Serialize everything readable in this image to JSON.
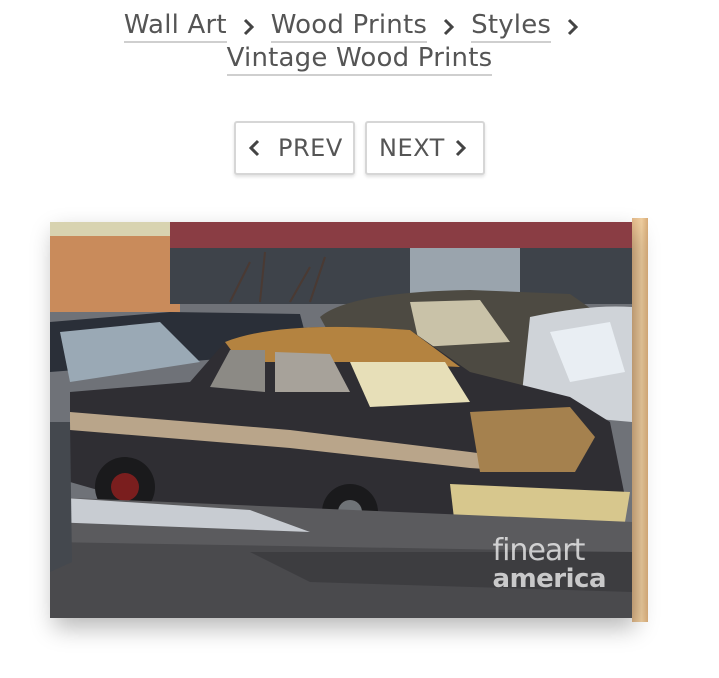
{
  "breadcrumb": {
    "items": [
      {
        "label": "Wall Art"
      },
      {
        "label": "Wood Prints"
      },
      {
        "label": "Styles"
      },
      {
        "label": "Vintage Wood Prints"
      }
    ]
  },
  "pager": {
    "prev_label": "PREV",
    "next_label": "NEXT"
  },
  "product": {
    "watermark_top": "fineart",
    "watermark_bottom": "america"
  },
  "colors": {
    "text": "#555555",
    "border": "#d6d6d6",
    "wood": "#e8c292"
  }
}
